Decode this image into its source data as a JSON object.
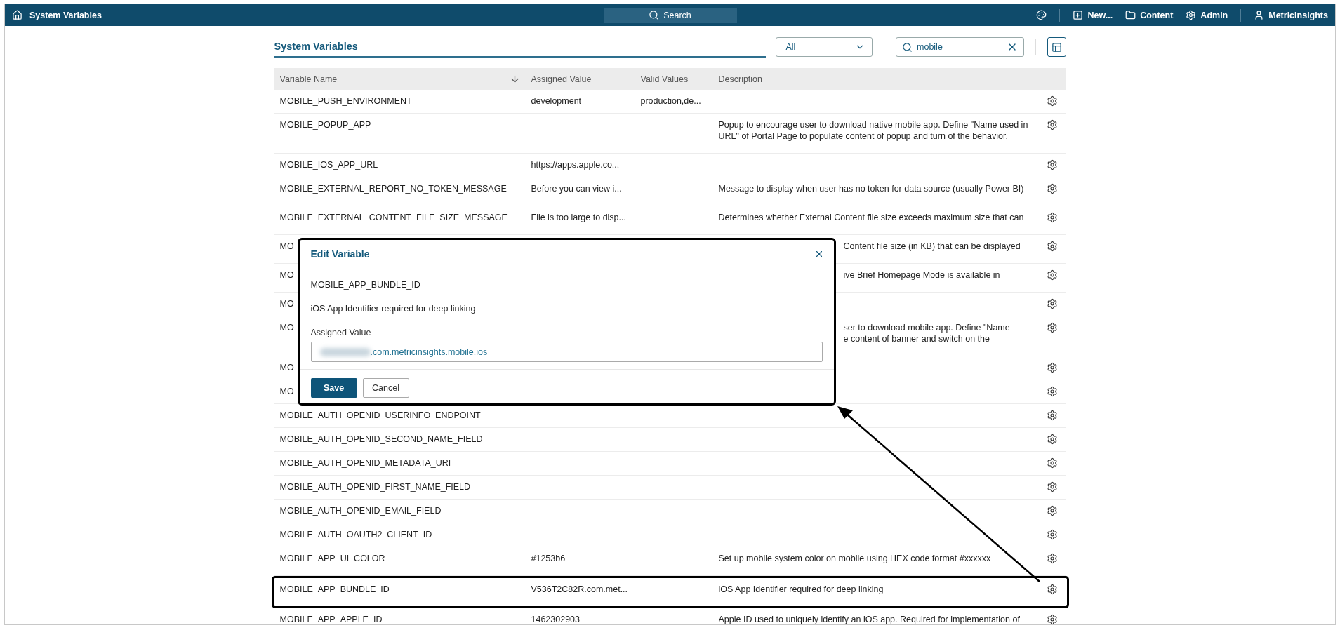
{
  "topbar": {
    "title": "System Variables",
    "search": "Search",
    "new_label": "New...",
    "content_label": "Content",
    "admin_label": "Admin",
    "user_label": "MetricInsights"
  },
  "header": {
    "title": "System Variables",
    "filter": "All",
    "search_value": "mobile"
  },
  "table": {
    "columns": [
      "Variable Name",
      "Assigned Value",
      "Valid Values",
      "Description"
    ],
    "rows": [
      {
        "name": "MOBILE_PUSH_ENVIRONMENT",
        "value": "development",
        "valid": "production,de...",
        "highlighted": false
      },
      {
        "name": "MOBILE_POPUP_APP",
        "description": "Popup to encourage user to download native mobile app. Define \"Name used in URL\" of Portal Page to populate content of popup and turn of the behavior.",
        "highlighted": false
      },
      {
        "name": "MOBILE_IOS_APP_URL",
        "value": "https://apps.apple.co...",
        "highlighted": false
      },
      {
        "name": "MOBILE_EXTERNAL_REPORT_NO_TOKEN_MESSAGE",
        "value": "Before you can view i...",
        "description": "Message to display when user has no token for data source (usually Power BI)",
        "highlighted": false
      },
      {
        "name": "MOBILE_EXTERNAL_CONTENT_FILE_SIZE_MESSAGE",
        "value": "File is too large to disp...",
        "description": "Determines whether External Content file size exceeds maximum size that can",
        "highlighted": false
      }
    ],
    "rows_under_dialog": [
      {
        "name": "MO",
        "description": "Content file size (in KB) that can be displayed"
      },
      {
        "name": "MO",
        "description": "ive Brief Homepage Mode is available in"
      },
      {
        "name": "MO"
      },
      {
        "name": "MO",
        "description": "ser to download mobile app. Define \"Name\ne content of banner and switch on the"
      },
      {
        "name": "MO"
      },
      {
        "name": "MO"
      }
    ],
    "rows_after": [
      {
        "name": "MOBILE_AUTH_OPENID_USERINFO_ENDPOINT",
        "highlighted": false
      },
      {
        "name": "MOBILE_AUTH_OPENID_SECOND_NAME_FIELD",
        "highlighted": false
      },
      {
        "name": "MOBILE_AUTH_OPENID_METADATA_URI",
        "highlighted": false
      },
      {
        "name": "MOBILE_AUTH_OPENID_FIRST_NAME_FIELD",
        "highlighted": false
      },
      {
        "name": "MOBILE_AUTH_OPENID_EMAIL_FIELD",
        "highlighted": false
      },
      {
        "name": "MOBILE_AUTH_OAUTH2_CLIENT_ID",
        "highlighted": false
      },
      {
        "name": "MOBILE_APP_UI_COLOR",
        "value": "#1253b6",
        "description": "Set up mobile system color on mobile using HEX code format #xxxxxx",
        "highlighted": false
      },
      {
        "name": "MOBILE_APP_BUNDLE_ID",
        "value": "V536T2C82R.com.met...",
        "description": "iOS App Identifier required for deep linking",
        "highlighted": true
      },
      {
        "name": "MOBILE_APP_APPLE_ID",
        "value": "1462302903",
        "description": "Apple ID used to uniquely identify an iOS app. Required for implementation of",
        "highlighted": false
      }
    ]
  },
  "dialog": {
    "title": "Edit Variable",
    "variable": "MOBILE_APP_BUNDLE_ID",
    "description": "iOS App Identifier required for deep linking",
    "field_label": "Assigned Value",
    "field_value": ".com.metricinsights.mobile.ios",
    "save": "Save",
    "cancel": "Cancel"
  }
}
